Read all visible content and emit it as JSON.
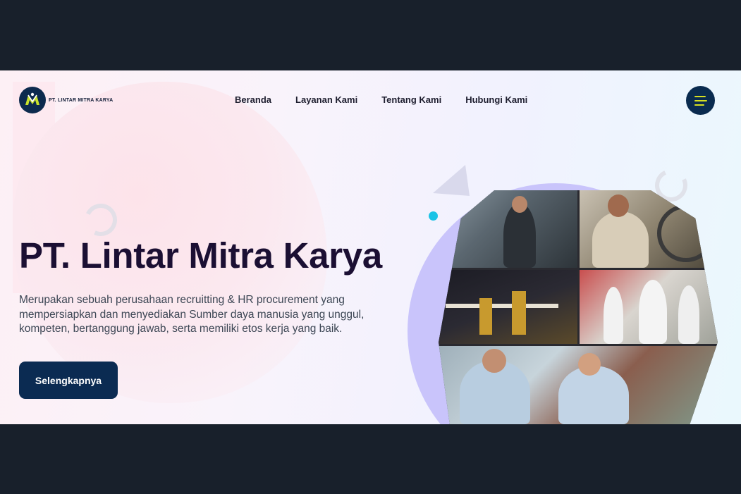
{
  "brand": {
    "name": "PT. LINTAR MITRA KARYA"
  },
  "nav": {
    "items": [
      {
        "label": "Beranda"
      },
      {
        "label": "Layanan Kami"
      },
      {
        "label": "Tentang Kami"
      },
      {
        "label": "Hubungi Kami"
      }
    ],
    "menu_icon": "hamburger-icon"
  },
  "hero": {
    "title": "PT. Lintar Mitra Karya",
    "description": "Merupakan sebuah perusahaan recruitting & HR procurement yang mempersiapkan dan menyediakan Sumber daya manusia yang unggul, kompeten, bertanggung jawab, serta memiliki etos kerja yang baik.",
    "cta_label": "Selengkapnya"
  },
  "colors": {
    "primary": "#0b2b52",
    "accent": "#d6e021",
    "title": "#1b0f33",
    "decor_cyan": "#1ac3e6",
    "decor_purple": "#c9c4fb"
  }
}
